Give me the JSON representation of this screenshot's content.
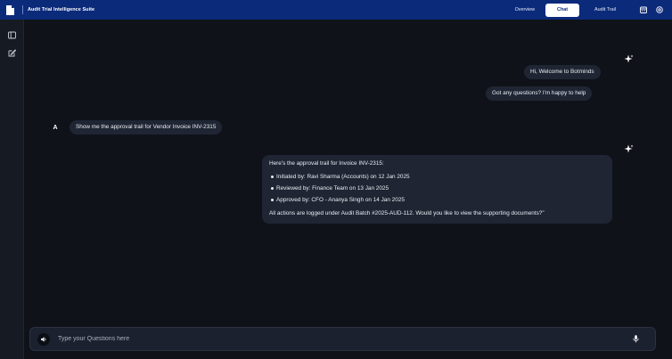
{
  "app": {
    "title": "Audit Trial Intelligence Suite"
  },
  "nav": {
    "overview": "Overview",
    "chat": "Chat",
    "audit_trail": "Audit Trail"
  },
  "icons": {
    "logo": "document-icon",
    "top_right": [
      "calendar-icon",
      "settings-icon"
    ],
    "sidebar": [
      "sidebar-toggle-icon",
      "new-chat-icon"
    ],
    "assistant": "sparkle-icon",
    "speaker": "speaker-icon",
    "mic": "microphone-icon"
  },
  "colors": {
    "topbar": "#0b2a7a",
    "background": "#0f1218",
    "bubble": "#1f2533",
    "accent_active_tab": "#ffffff"
  },
  "messages": {
    "bot_greeting_1": "Hi, Welcome to Botminds",
    "bot_greeting_2": "Got any questions? I'm happy to help",
    "user_avatar": "A",
    "user_question": "Show me the approval trail for Vendor Invoice INV-2315",
    "answer": {
      "intro": "Here's the approval trail for Invoice INV-2315:",
      "items": [
        "Initiated by: Ravi Sharma (Accounts) on 12 Jan 2025",
        "Reviewed by: Finance Team on 13 Jan 2025",
        "Approved by: CFO - Ananya Singh on 14 Jan 2025"
      ],
      "outro": "All actions are logged under Audit Batch #2025-AUD-112. Would you like to view the supporting documents?\""
    }
  },
  "input": {
    "placeholder": "Type your Questions here",
    "value": ""
  }
}
